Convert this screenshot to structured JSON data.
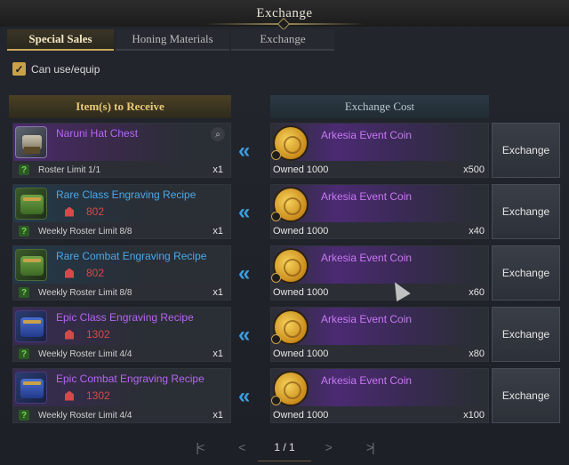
{
  "window": {
    "title": "Exchange"
  },
  "tabs": [
    {
      "label": "Special Sales",
      "active": true
    },
    {
      "label": "Honing Materials",
      "active": false
    },
    {
      "label": "Exchange",
      "active": false
    }
  ],
  "filter": {
    "label": "Can use/equip",
    "checked": true
  },
  "headers": {
    "receive": "Item(s) to Receive",
    "cost": "Exchange Cost"
  },
  "rows": [
    {
      "item_name": "Naruni Hat Chest",
      "rarity": "epic",
      "icon": "hat-chest-icon",
      "honing": "",
      "limit": "Roster Limit 1/1",
      "qty": "x1",
      "coin_name": "Arkesia Event Coin",
      "owned": "Owned 1000",
      "cost": "x500",
      "button": "Exchange"
    },
    {
      "item_name": "Rare Class Engraving Recipe",
      "rarity": "rare",
      "icon": "engraving-book-icon",
      "honing": "802",
      "limit": "Weekly Roster Limit 8/8",
      "qty": "x1",
      "coin_name": "Arkesia Event Coin",
      "owned": "Owned 1000",
      "cost": "x40",
      "button": "Exchange"
    },
    {
      "item_name": "Rare Combat Engraving Recipe",
      "rarity": "rare",
      "icon": "engraving-book-icon",
      "honing": "802",
      "limit": "Weekly Roster Limit 8/8",
      "qty": "x1",
      "coin_name": "Arkesia Event Coin",
      "owned": "Owned 1000",
      "cost": "x60",
      "button": "Exchange"
    },
    {
      "item_name": "Epic Class Engraving Recipe",
      "rarity": "epic",
      "icon": "engraving-book-icon",
      "honing": "1302",
      "limit": "Weekly Roster Limit 4/4",
      "qty": "x1",
      "coin_name": "Arkesia Event Coin",
      "owned": "Owned 1000",
      "cost": "x80",
      "button": "Exchange"
    },
    {
      "item_name": "Epic Combat Engraving Recipe",
      "rarity": "epic",
      "icon": "engraving-book-icon",
      "honing": "1302",
      "limit": "Weekly Roster Limit 4/4",
      "qty": "x1",
      "coin_name": "Arkesia Event Coin",
      "owned": "Owned 1000",
      "cost": "x100",
      "button": "Exchange"
    }
  ],
  "pagination": {
    "first": "|<",
    "prev": "<",
    "page": "1 / 1",
    "next": ">",
    "last": ">|"
  }
}
